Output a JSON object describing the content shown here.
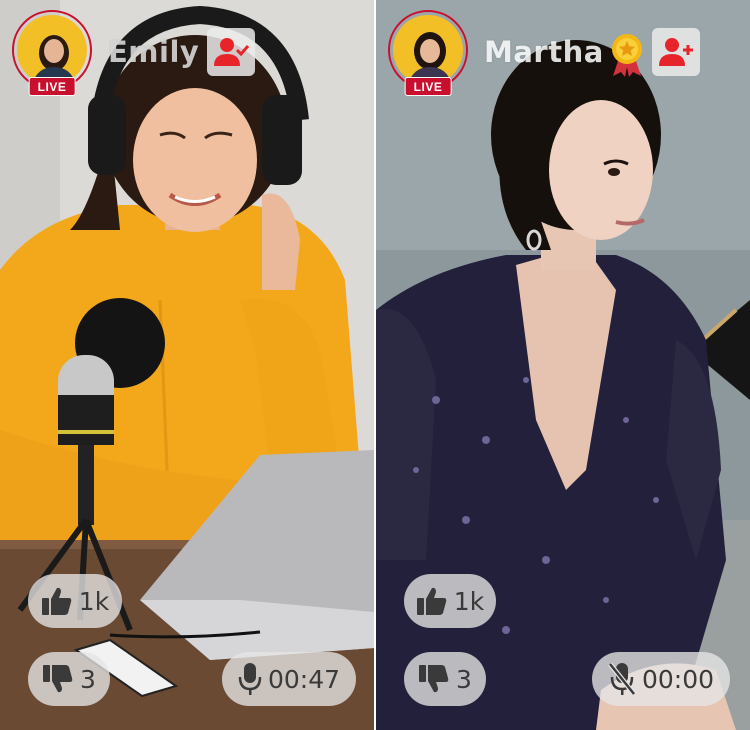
{
  "streams": [
    {
      "host_name": "Emily",
      "live_label": "LIVE",
      "likes": "1k",
      "dislikes": "3",
      "mic_timer": "00:47",
      "mic_muted": false,
      "following": true
    },
    {
      "host_name": "Martha",
      "live_label": "LIVE",
      "likes": "1k",
      "dislikes": "3",
      "mic_timer": "00:00",
      "mic_muted": true,
      "following": false,
      "badge_icon": "gold-medal-icon"
    }
  ],
  "colors": {
    "live_red": "#c8102e",
    "avatar_bg": "#f2c026",
    "follow_icon": "#e8242b",
    "pill_bg": "#e6e6e6",
    "pill_text": "#3a3a3a"
  }
}
